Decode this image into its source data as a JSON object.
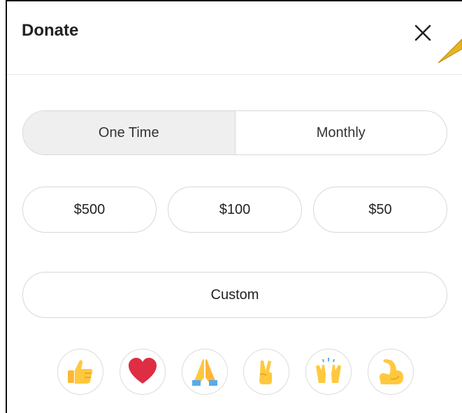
{
  "dialog": {
    "title": "Donate"
  },
  "frequency": {
    "options": [
      "One Time",
      "Monthly"
    ],
    "selected": "One Time"
  },
  "amounts": [
    "$500",
    "$100",
    "$50"
  ],
  "custom_label": "Custom",
  "reactions": [
    {
      "icon": "thumbs-up-icon"
    },
    {
      "icon": "heart-icon"
    },
    {
      "icon": "praying-hands-icon"
    },
    {
      "icon": "victory-hand-icon"
    },
    {
      "icon": "raising-hands-icon"
    },
    {
      "icon": "flexed-biceps-icon"
    }
  ],
  "colors": {
    "selected_bg": "#efefef",
    "border": "#d8d8d8",
    "emoji_yellow": "#FFC83D",
    "heart_red": "#DD2E44",
    "pointer": "#E8B422"
  }
}
